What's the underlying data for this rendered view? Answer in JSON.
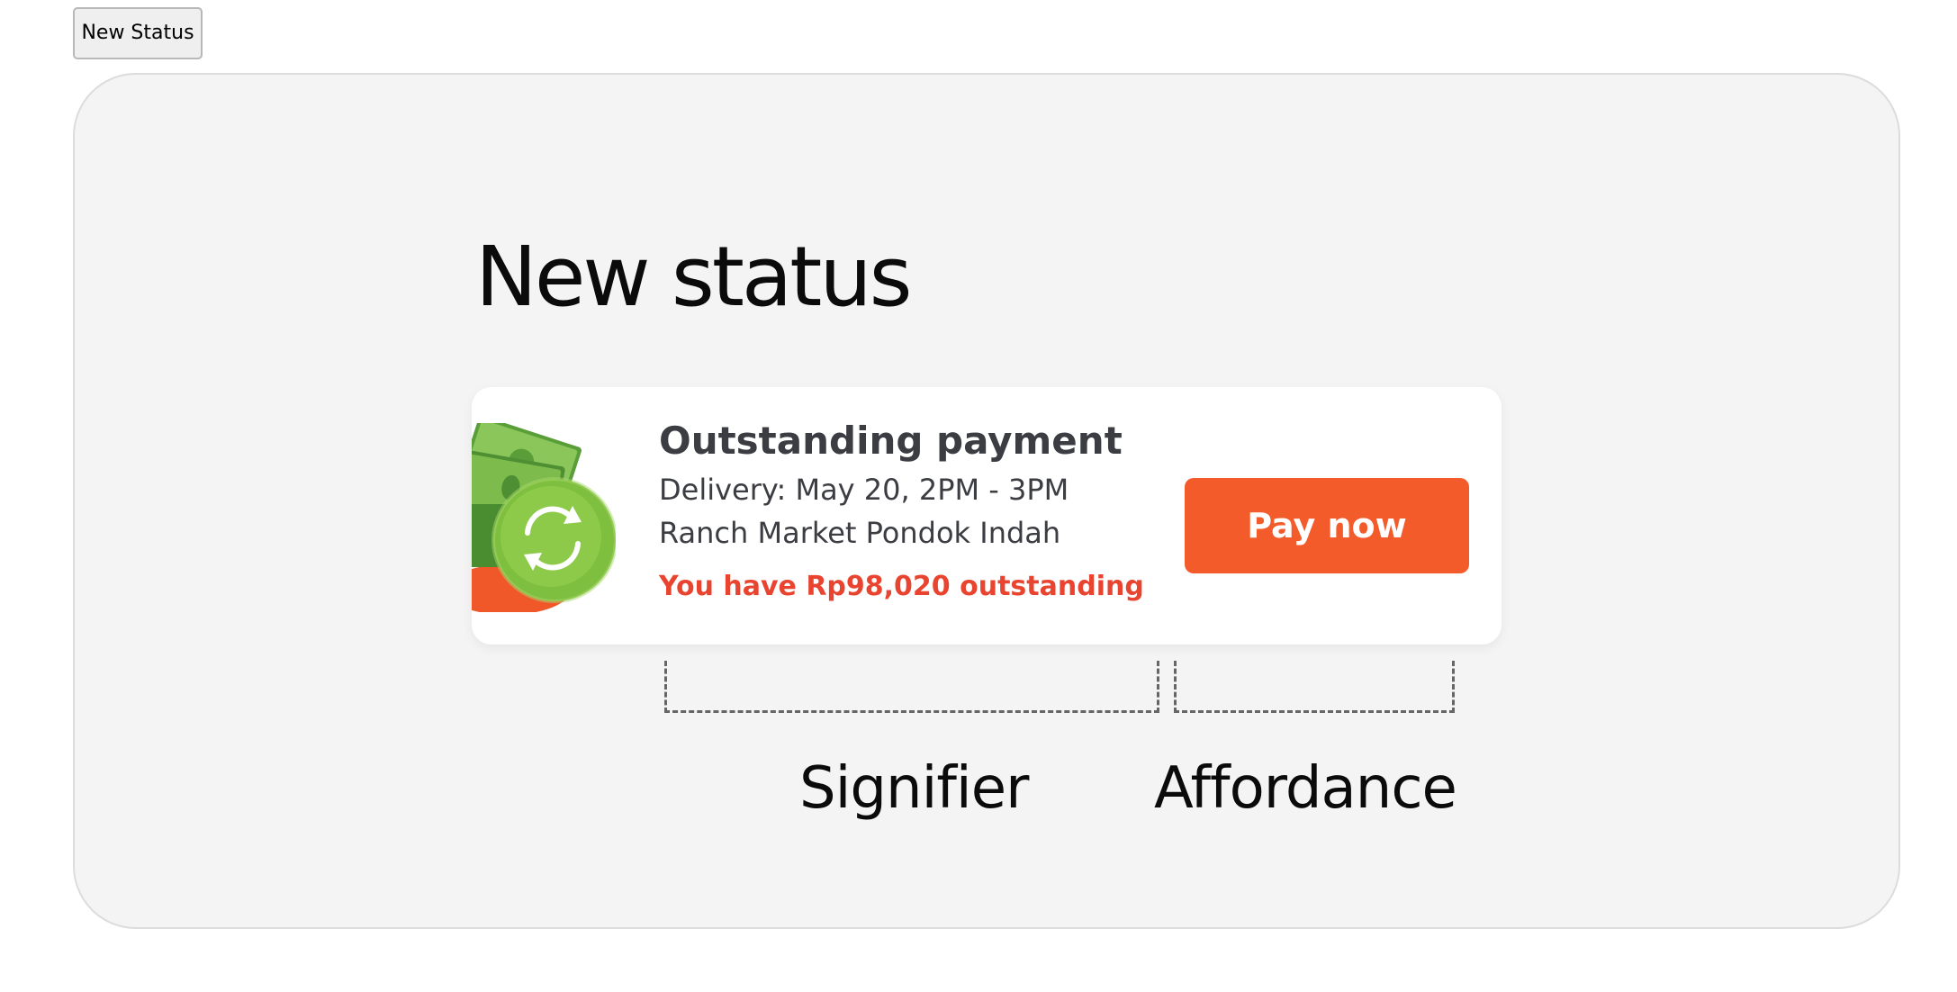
{
  "toolbar": {
    "new_status_button_label": "New Status"
  },
  "slide": {
    "title": "New status"
  },
  "status_card": {
    "title": "Outstanding payment",
    "delivery": "Delivery: May 20, 2PM - 3PM",
    "store": "Ranch Market Pondok Indah",
    "outstanding": "You have Rp98,020 outstanding",
    "pay_button_label": "Pay now",
    "icon": "money-refresh-icon"
  },
  "annotations": {
    "signifier_label": "Signifier",
    "affordance_label": "Affordance"
  },
  "colors": {
    "accent": "#f45b2a",
    "warning_text": "#e8442f",
    "card_text": "#3b3d42",
    "frame_background": "#f4f4f4",
    "money_green": "#8bc34a"
  }
}
